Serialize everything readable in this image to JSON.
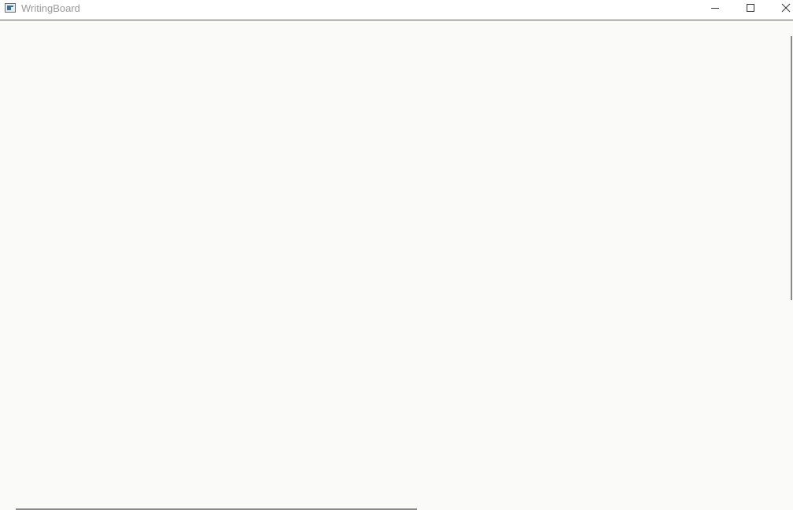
{
  "window": {
    "title": "WritingBoard",
    "app_icon": "window-app-icon",
    "controls": {
      "minimize_icon": "minimize-icon",
      "maximize_icon": "maximize-icon",
      "close_icon": "close-icon"
    }
  },
  "colors": {
    "background": "#fafaf8",
    "titlebar": "#ffffff",
    "title_text": "#9a9a9a",
    "scrollbar": "#8a8a8a"
  }
}
